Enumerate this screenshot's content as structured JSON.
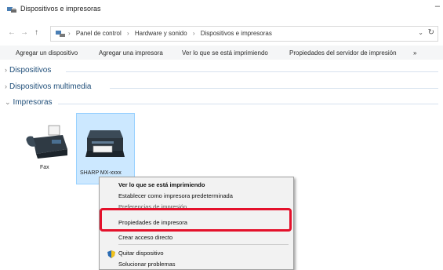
{
  "window": {
    "title": "Dispositivos e impresoras",
    "min_glyph": "–"
  },
  "nav": {
    "back_glyph": "←",
    "forward_glyph": "→",
    "up_glyph": "↑"
  },
  "address": {
    "crumbs": [
      "Panel de control",
      "Hardware y sonido",
      "Dispositivos e impresoras"
    ],
    "separator": "›",
    "dropdown_glyph": "⌄",
    "refresh_glyph": "↻"
  },
  "command_bar": {
    "items": [
      "Agregar un dispositivo",
      "Agregar una impresora",
      "Ver lo que se está imprimiendo",
      "Propiedades del servidor de impresión",
      "»"
    ]
  },
  "sections": {
    "collapsed_chev": "›",
    "expanded_chev": "⌄",
    "dispositivos": "Dispositivos",
    "multimedia": "Dispositivos multimedia",
    "impresoras": "Impresoras"
  },
  "devices": [
    {
      "label": "Fax",
      "icon": "fax-icon"
    },
    {
      "label": "SHARP MX-xxxx",
      "icon": "printer-icon"
    }
  ],
  "context_menu": {
    "items": [
      "Ver lo que se está imprimiendo",
      "Establecer como impresora predeterminada",
      "Preferencias de impresión",
      "Propiedades de impresora",
      "Crear acceso directo",
      "Quitar dispositivo",
      "Solucionar problemas"
    ],
    "highlighted": "Propiedades de impresora",
    "highlight_color": "#e4112b"
  },
  "colors": {
    "section_text": "#1f4e79",
    "selection_fill": "#cce8ff",
    "selection_border": "#99d1ff"
  }
}
